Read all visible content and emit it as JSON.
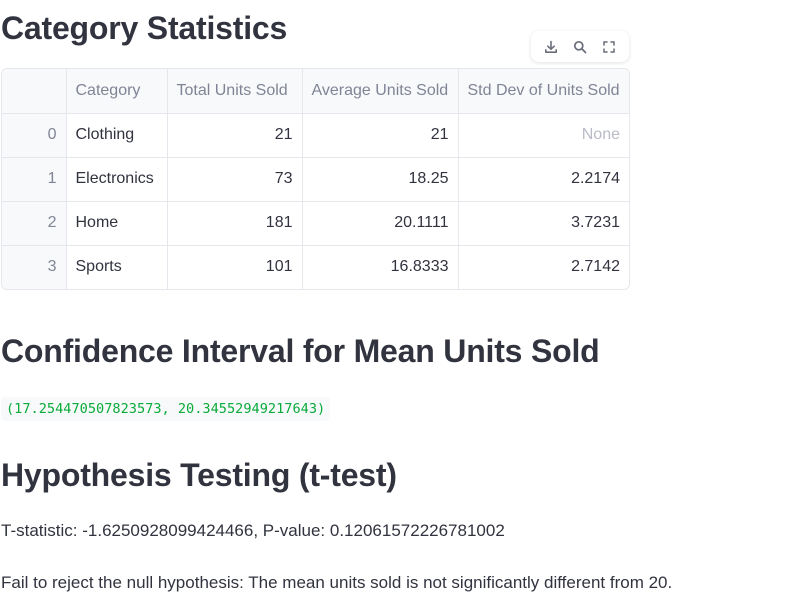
{
  "section1": {
    "title": "Category Statistics"
  },
  "toolbar": {
    "download_icon": "download-icon",
    "search_icon": "search-icon",
    "fullscreen_icon": "fullscreen-icon"
  },
  "table": {
    "columns": [
      "",
      "Category",
      "Total Units Sold",
      "Average Units Sold",
      "Std Dev of Units Sold"
    ],
    "rows": [
      {
        "index": "0",
        "category": "Clothing",
        "total": "21",
        "average": "21",
        "std": "None"
      },
      {
        "index": "1",
        "category": "Electronics",
        "total": "73",
        "average": "18.25",
        "std": "2.2174"
      },
      {
        "index": "2",
        "category": "Home",
        "total": "181",
        "average": "20.1111",
        "std": "3.7231"
      },
      {
        "index": "3",
        "category": "Sports",
        "total": "101",
        "average": "16.8333",
        "std": "2.7142"
      }
    ]
  },
  "section2": {
    "title": "Confidence Interval for Mean Units Sold",
    "interval": "(17.254470507823573, 20.34552949217643)"
  },
  "section3": {
    "title": "Hypothesis Testing (t-test)",
    "stat_line": "T-statistic: -1.6250928099424466, P-value: 0.12061572226781002",
    "conclusion": "Fail to reject the null hypothesis: The mean units sold is not significantly different from 20."
  },
  "colors": {
    "text": "#31333f",
    "muted": "#808495",
    "code_green": "#09ab3b",
    "header_bg": "#f8f9fb",
    "border": "#e6e7ec"
  }
}
